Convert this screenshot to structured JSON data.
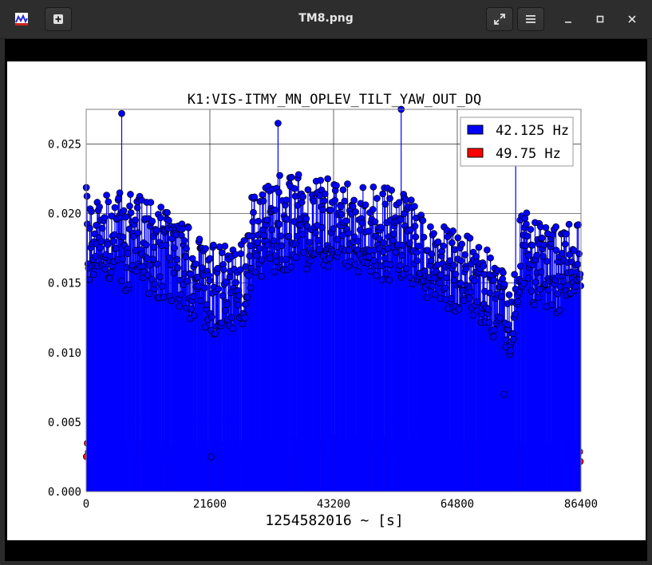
{
  "window": {
    "title": "TM8.png",
    "icons": [
      "image-viewer-app-icon",
      "new-tab-icon",
      "fullscreen-icon",
      "hamburger-menu-icon",
      "minimize-icon",
      "maximize-icon",
      "close-icon"
    ]
  },
  "chart_data": {
    "type": "scatter",
    "title": "K1:VIS-ITMY_MN_OPLEV_TILT_YAW_OUT_DQ",
    "xlabel": "1254582016 ~ [s]",
    "ylabel": "",
    "xlim": [
      0,
      86400
    ],
    "ylim": [
      0,
      0.0275
    ],
    "xticks": [
      0,
      21600,
      43200,
      64800,
      86400
    ],
    "xtick_labels": [
      "0",
      "21600",
      "43200",
      "64800",
      "86400"
    ],
    "yticks": [
      0.0,
      0.005,
      0.01,
      0.015,
      0.02,
      0.025
    ],
    "ytick_labels": [
      "0.000",
      "0.005",
      "0.010",
      "0.015",
      "0.020",
      "0.025"
    ],
    "grid": true,
    "legend_position": "top-right",
    "series": [
      {
        "name": "42.125 Hz",
        "color": "#0000ff",
        "style": "stem",
        "trend": {
          "x": [
            0,
            3000,
            6000,
            9000,
            12000,
            15000,
            18000,
            20000,
            21600,
            24000,
            26000,
            27500,
            29000,
            32000,
            36000,
            40000,
            44000,
            48000,
            52000,
            55000,
            58000,
            60000,
            63000,
            66000,
            68000,
            70000,
            72000,
            73500,
            74500,
            76000,
            78000,
            80000,
            82000,
            84000,
            86400
          ],
          "y": [
            0.0185,
            0.0182,
            0.018,
            0.0178,
            0.0175,
            0.017,
            0.0158,
            0.0148,
            0.0145,
            0.0145,
            0.0148,
            0.0152,
            0.0185,
            0.0192,
            0.0195,
            0.0195,
            0.0195,
            0.019,
            0.0185,
            0.0182,
            0.0175,
            0.0165,
            0.016,
            0.0155,
            0.0152,
            0.0148,
            0.0135,
            0.0125,
            0.0125,
            0.0175,
            0.0165,
            0.0158,
            0.016,
            0.0165,
            0.0175
          ],
          "spread": [
            0.0035,
            0.0035,
            0.0035,
            0.0035,
            0.0035,
            0.0035,
            0.0033,
            0.0033,
            0.0033,
            0.0033,
            0.0032,
            0.0032,
            0.0035,
            0.0035,
            0.0035,
            0.0035,
            0.0035,
            0.0035,
            0.0035,
            0.0033,
            0.0032,
            0.003,
            0.003,
            0.003,
            0.003,
            0.003,
            0.003,
            0.0028,
            0.0028,
            0.0032,
            0.0032,
            0.0032,
            0.0032,
            0.0032,
            0.0032
          ]
        },
        "outliers": [
          {
            "x": 6200,
            "y": 0.0272
          },
          {
            "x": 33500,
            "y": 0.0265
          },
          {
            "x": 55000,
            "y": 0.0275
          },
          {
            "x": 21800,
            "y": 0.0025
          },
          {
            "x": 73000,
            "y": 0.007
          },
          {
            "x": 75000,
            "y": 0.0253
          }
        ]
      },
      {
        "name": "49.75 Hz",
        "color": "#ff0000",
        "style": "stem",
        "trend": {
          "x": [
            0,
            21600,
            43200,
            64800,
            86400
          ],
          "y": [
            0.0028,
            0.0027,
            0.0032,
            0.0028,
            0.0028
          ],
          "spread": [
            0.0007,
            0.0007,
            0.0007,
            0.0007,
            0.0007
          ]
        },
        "outliers": [
          {
            "x": 57800,
            "y": 0.0048
          },
          {
            "x": 60500,
            "y": 0.0042
          }
        ]
      }
    ]
  }
}
